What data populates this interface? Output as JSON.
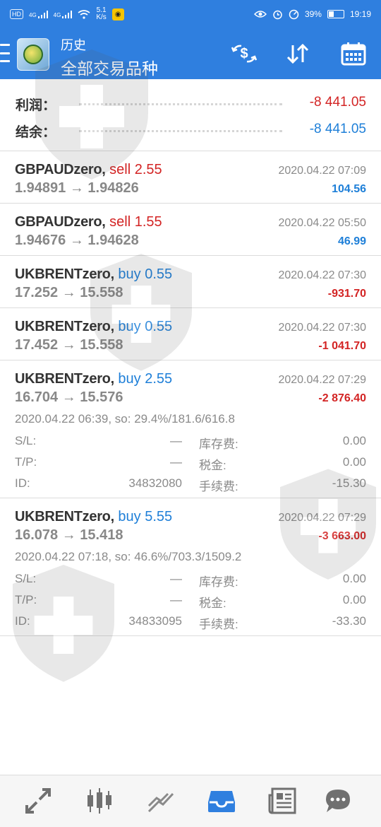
{
  "status_bar": {
    "hd": "HD",
    "net1": "4G",
    "net2": "4G",
    "speed_value": "5.1",
    "speed_unit": "K/s",
    "battery": "39%",
    "time": "19:19"
  },
  "header": {
    "subtitle": "历史",
    "title": "全部交易品种",
    "icons": [
      "currency-exchange-icon",
      "sort-arrows-icon",
      "calendar-icon"
    ]
  },
  "summary": {
    "profit_label": "利润：",
    "profit_value": "-8 441.05",
    "balance_label": "结余：",
    "balance_value": "-8 441.05"
  },
  "trades": [
    {
      "symbol": "GBPAUDzero,",
      "side": "sell",
      "volume": "2.55",
      "prices": "1.94891 → 1.94826",
      "date": "2020.04.22 07:09",
      "profit": "104.56"
    },
    {
      "symbol": "GBPAUDzero,",
      "side": "sell",
      "volume": "1.55",
      "prices": "1.94676 → 1.94628",
      "date": "2020.04.22 05:50",
      "profit": "46.99"
    },
    {
      "symbol": "UKBRENTzero,",
      "side": "buy",
      "volume": "0.55",
      "prices": "17.252 → 15.558",
      "date": "2020.04.22 07:30",
      "profit": "-931.70"
    },
    {
      "symbol": "UKBRENTzero,",
      "side": "buy",
      "volume": "0.55",
      "prices": "17.452 → 15.558",
      "date": "2020.04.22 07:30",
      "profit": "-1 041.70"
    },
    {
      "symbol": "UKBRENTzero,",
      "side": "buy",
      "volume": "2.55",
      "prices": "16.704 → 15.576",
      "date": "2020.04.22 07:29",
      "profit": "-2 876.40",
      "details": {
        "open_info": "2020.04.22 06:39, so: 29.4%/181.6/616.8",
        "sl_label": "S/L:",
        "sl_value": "—",
        "tp_label": "T/P:",
        "tp_value": "—",
        "id_label": "ID:",
        "id_value": "34832080",
        "swap_label": "库存费:",
        "swap_value": "0.00",
        "tax_label": "税金:",
        "tax_value": "0.00",
        "commission_label": "手续费:",
        "commission_value": "-15.30"
      }
    },
    {
      "symbol": "UKBRENTzero,",
      "side": "buy",
      "volume": "5.55",
      "prices": "16.078 → 15.418",
      "date": "2020.04.22 07:29",
      "profit": "-3 663.00",
      "details": {
        "open_info": "2020.04.22 07:18, so: 46.6%/703.3/1509.2",
        "sl_label": "S/L:",
        "sl_value": "—",
        "tp_label": "T/P:",
        "tp_value": "—",
        "id_label": "ID:",
        "id_value": "34833095",
        "swap_label": "库存费:",
        "swap_value": "0.00",
        "tax_label": "税金:",
        "tax_value": "0.00",
        "commission_label": "手续费:",
        "commission_value": "-33.30"
      }
    }
  ],
  "bottom_nav": [
    "quotes-arrows-icon",
    "chart-candles-icon",
    "trade-line-icon",
    "history-inbox-icon",
    "news-icon",
    "chat-icon"
  ],
  "colors": {
    "header_bg": "#2f7fdf",
    "sell": "#d32424",
    "buy": "#1e7fd8",
    "negative": "#d32424",
    "positive": "#1e7fd8",
    "active_nav": "#2f7fdf"
  }
}
